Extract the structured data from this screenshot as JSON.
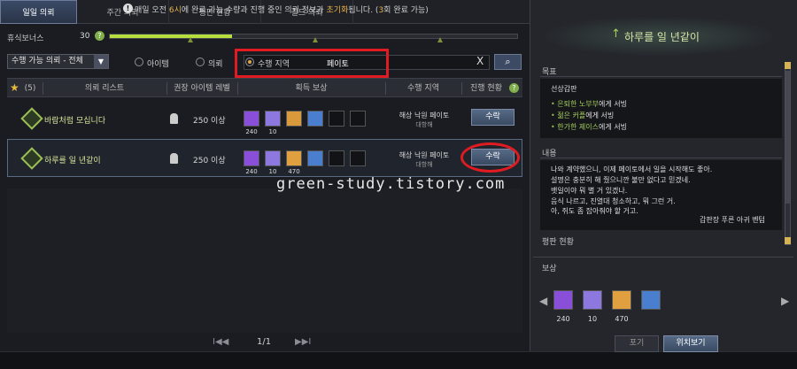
{
  "tabs": [
    {
      "label": "일일 의뢰"
    },
    {
      "label": "주간 의뢰"
    },
    {
      "label": "평판 현황"
    },
    {
      "label": "길드 의뢰"
    }
  ],
  "rest_bonus": {
    "label": "휴식보너스",
    "value": "30",
    "help": "?",
    "fill_fraction": 0.3
  },
  "filter": {
    "select_value": "수행 가능 의뢰 - 전체",
    "radio_item": "아이템",
    "radio_quest": "의뢰",
    "radio_area": "수행 지역",
    "search_value": "페이토",
    "clear": "X"
  },
  "table": {
    "count": "(5)",
    "headers": {
      "list": "의뢰 리스트",
      "level": "권장 아이템 레벨",
      "reward": "획득 보상",
      "area": "수행 지역",
      "progress": "진행 현황",
      "help": "?"
    },
    "rows": [
      {
        "name": "바람처럼 모십니다",
        "level": "250 이상",
        "area": "해상 낙원 페이토",
        "region": "대항해",
        "button": "수락",
        "rewards": [
          {
            "count": "240",
            "color": "#8a4fd8"
          },
          {
            "count": "10",
            "color": "#8d78e0"
          },
          {
            "count": "",
            "color": "#d89a3a"
          },
          {
            "count": "",
            "color": "#4a7fd0"
          }
        ]
      },
      {
        "name": "하루를 일 년같이",
        "level": "250 이상",
        "area": "해상 낙원 페이토",
        "region": "대항해",
        "button": "수락",
        "rewards": [
          {
            "count": "240",
            "color": "#8a4fd8"
          },
          {
            "count": "10",
            "color": "#8d78e0"
          },
          {
            "count": "470",
            "color": "#e0a040"
          },
          {
            "count": "",
            "color": "#4a7fd0"
          }
        ]
      }
    ]
  },
  "watermark": "green-study.tistory.com",
  "pager": {
    "first": "I◀◀",
    "page": "1/1",
    "last": "▶▶I"
  },
  "notice": {
    "icon": "!",
    "pre": "매일 오전 ",
    "hl1": "6시",
    "mid": "에 완료 가능 수량과 진행 중인 의뢰 정보가 ",
    "hl2": "초기화",
    "post": "됩니다. (",
    "hl3": "3",
    "end": "회 완료 가능)"
  },
  "detail": {
    "title": "하루를 일 년같이",
    "goal_label": "목표",
    "goal_title": "선상갑판",
    "goals": [
      {
        "hl": "은퇴한 노부부",
        "rest": "에게 서빙"
      },
      {
        "hl": "젊은 커플",
        "rest": "에게 서빙"
      },
      {
        "hl": "한가한 제이스",
        "rest": "에게 서빙"
      }
    ],
    "content_label": "내용",
    "content_lines": [
      "나와 계약했으니, 이제 페이토에서 일을 시작해도 좋아.",
      "설명은 충분히 해 줬으니깐 불만 없다고 믿겠네.",
      "뱃일이야 뭐 별 거 있겠나.",
      "음식 나르고, 진열대 청소하고, 뭐 그런 거.",
      "아, 쥐도 좀 잡아줘야 할 거고."
    ],
    "content_sign": "갑판장 푸른 아귀 벤텀",
    "rep_label": "평판 현황",
    "reward_label": "보상",
    "rewards": [
      {
        "count": "240",
        "color": "#8a4fd8"
      },
      {
        "count": "10",
        "color": "#8d78e0"
      },
      {
        "count": "470",
        "color": "#e0a040"
      },
      {
        "count": "",
        "color": "#4a7fd0"
      }
    ],
    "btn_abandon": "포기",
    "btn_locate": "위치보기"
  }
}
